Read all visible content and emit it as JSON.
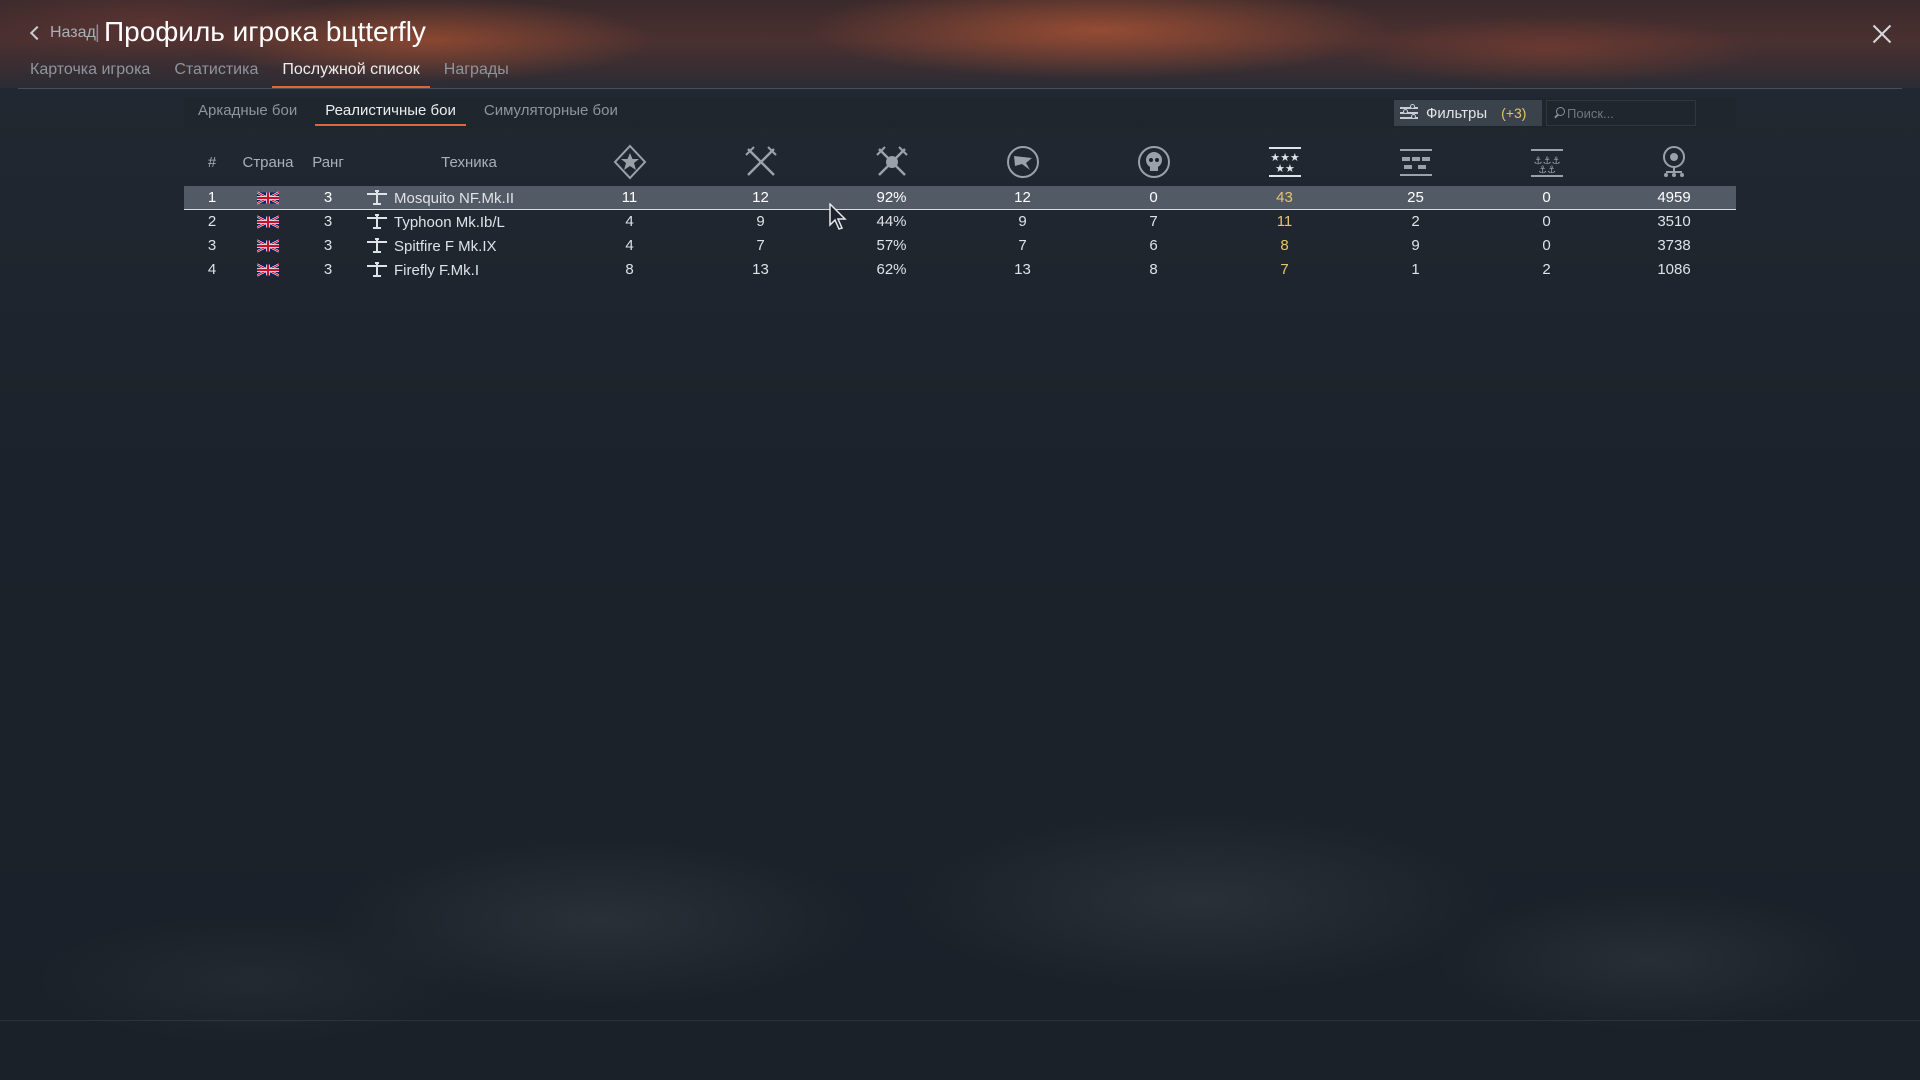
{
  "header": {
    "back_label": "Назад",
    "separator": "|",
    "title": "Профиль игрока bцtterfly",
    "tabs": [
      {
        "label": "Карточка игрока"
      },
      {
        "label": "Статистика"
      },
      {
        "label": "Послужной список",
        "active": true
      },
      {
        "label": "Награды"
      }
    ]
  },
  "mode_tabs": [
    {
      "label": "Аркадные бои"
    },
    {
      "label": "Реалистичные бои",
      "active": true
    },
    {
      "label": "Симуляторные бои"
    }
  ],
  "filter": {
    "label": "Фильтры",
    "count": "(+3)"
  },
  "search": {
    "placeholder": "Поиск..."
  },
  "table": {
    "headers": {
      "num": "#",
      "country": "Страна",
      "rank": "Ранг",
      "vehicle": "Техника"
    },
    "stat_icons": [
      "battles-icon",
      "victories-icon",
      "win-rate-icon",
      "respawns-icon",
      "deaths-icon",
      "air-kills-icon",
      "ground-kills-icon",
      "naval-kills-icon",
      "activity-icon"
    ],
    "rows": [
      {
        "num": "1",
        "country": "uk-flag",
        "rank": "3",
        "vehicle": "Mosquito NF.Mk.II",
        "battles": "11",
        "victories": "12",
        "win_rate": "92%",
        "respawns": "12",
        "deaths": "0",
        "air_kills": "43",
        "ground_kills": "25",
        "naval_kills": "0",
        "activity": "4959",
        "selected": true
      },
      {
        "num": "2",
        "country": "uk-flag",
        "rank": "3",
        "vehicle": "Typhoon Mk.Ib/L",
        "battles": "4",
        "victories": "9",
        "win_rate": "44%",
        "respawns": "9",
        "deaths": "7",
        "air_kills": "11",
        "ground_kills": "2",
        "naval_kills": "0",
        "activity": "3510"
      },
      {
        "num": "3",
        "country": "uk-flag",
        "rank": "3",
        "vehicle": "Spitfire F Mk.IX",
        "battles": "4",
        "victories": "7",
        "win_rate": "57%",
        "respawns": "7",
        "deaths": "6",
        "air_kills": "8",
        "ground_kills": "9",
        "naval_kills": "0",
        "activity": "3738"
      },
      {
        "num": "4",
        "country": "uk-flag",
        "rank": "3",
        "vehicle": "Firefly F.Mk.I",
        "battles": "8",
        "victories": "13",
        "win_rate": "62%",
        "respawns": "13",
        "deaths": "8",
        "air_kills": "7",
        "ground_kills": "1",
        "naval_kills": "2",
        "activity": "1086"
      }
    ]
  },
  "colors": {
    "accent": "#e0663a",
    "gold": "#e6c66a",
    "selected_row": "#525a65"
  }
}
